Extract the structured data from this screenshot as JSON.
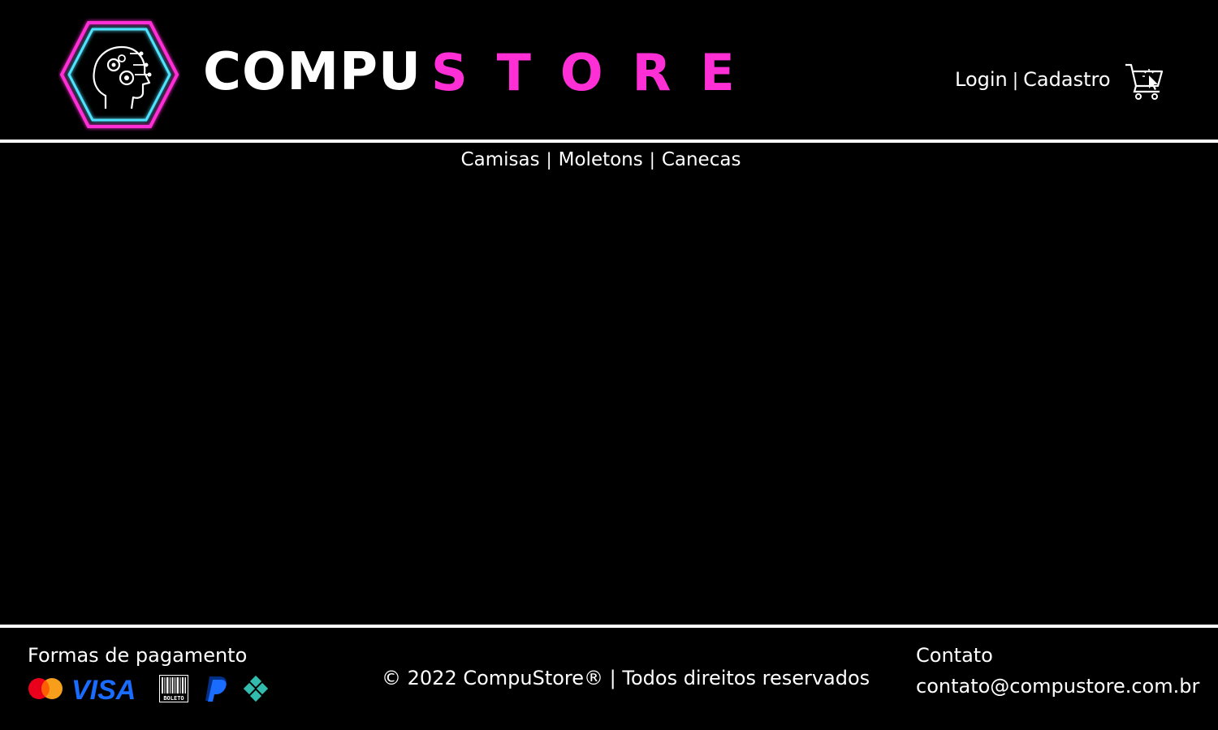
{
  "brand": {
    "name_part1": "COMPU",
    "name_part2": "STORE",
    "logo_icon": "gear-head-hexagon-icon",
    "accent_color": "#ff2fd6",
    "logo_cyan": "#4fe3ff"
  },
  "header": {
    "login_label": "Login",
    "separator": "|",
    "signup_label": "Cadastro",
    "cart_icon": "shopping-cart-icon"
  },
  "nav": {
    "items": [
      {
        "label": "Camisas"
      },
      {
        "label": "Moletons"
      },
      {
        "label": "Canecas"
      }
    ],
    "separator": "|"
  },
  "footer": {
    "payment_title": "Formas de pagamento",
    "payment_methods": [
      {
        "icon": "mastercard-icon"
      },
      {
        "icon": "visa-icon",
        "text": "VISA"
      },
      {
        "icon": "boleto-icon",
        "text": "BOLETO"
      },
      {
        "icon": "paypal-icon"
      },
      {
        "icon": "pix-icon"
      }
    ],
    "copyright": "© 2022 CompuStore® | Todos direitos reservados",
    "contact_title": "Contato",
    "contact_email": "contato@compustore.com.br"
  }
}
